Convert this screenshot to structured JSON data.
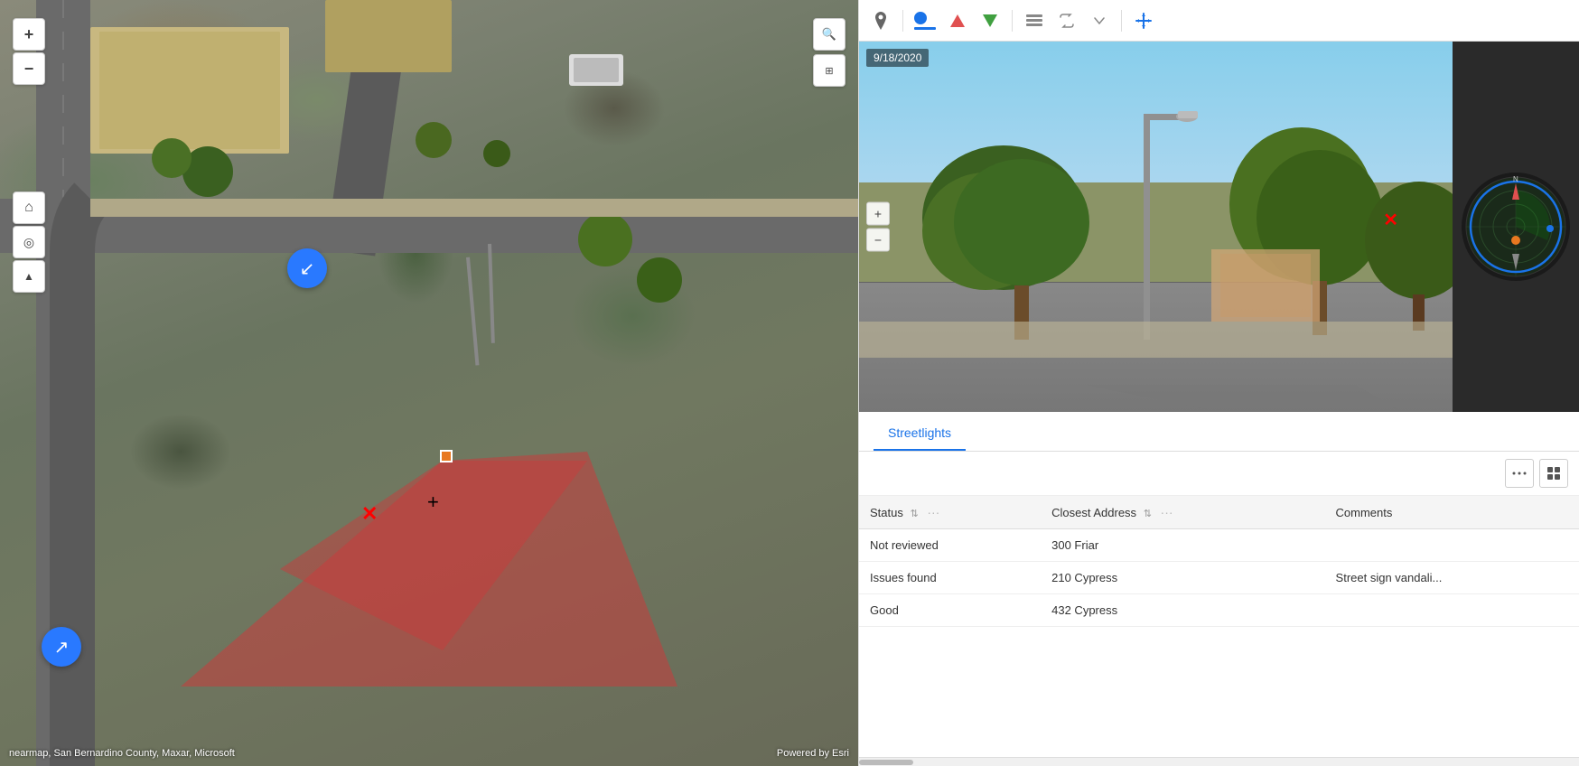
{
  "map": {
    "attribution_left": "nearmap, San Bernardino County, Maxar, Microsoft",
    "attribution_right": "Powered by Esri"
  },
  "toolbar": {
    "icons": [
      "pin",
      "circle-blue",
      "triangle-red",
      "triangle-green",
      "layers",
      "arrows",
      "chevron-down",
      "move"
    ]
  },
  "streetview": {
    "date": "9/18/2020"
  },
  "tabs": [
    {
      "label": "Streetlights",
      "active": true
    }
  ],
  "table": {
    "columns": [
      {
        "label": "Status",
        "sortable": true,
        "more": true
      },
      {
        "label": "Closest Address",
        "sortable": true,
        "more": true
      },
      {
        "label": "Comments",
        "sortable": false,
        "more": false
      }
    ],
    "rows": [
      {
        "status": "Not reviewed",
        "address": "300 Friar",
        "comments": ""
      },
      {
        "status": "Issues found",
        "address": "210 Cypress",
        "comments": "Street sign vandali..."
      },
      {
        "status": "Good",
        "address": "432 Cypress",
        "comments": ""
      }
    ],
    "toolbar_buttons": [
      "more",
      "grid"
    ]
  },
  "map_controls": {
    "zoom_in": "+",
    "zoom_out": "−",
    "home": "⌂",
    "locate": "◎",
    "compass": "▲",
    "search": "🔍",
    "qr": "⊞"
  }
}
